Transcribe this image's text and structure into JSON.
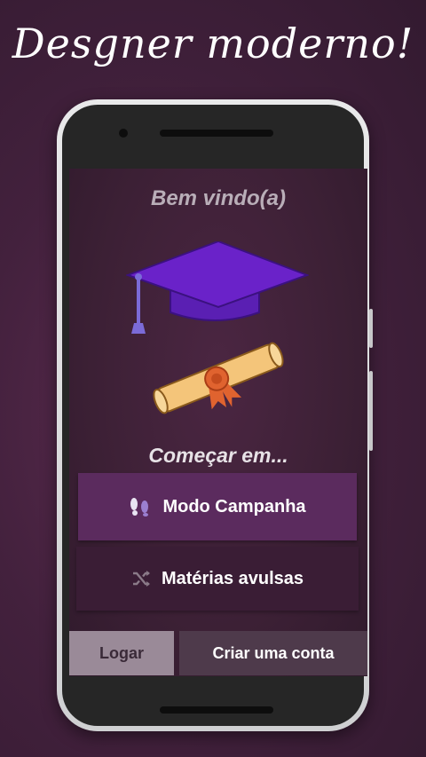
{
  "banner": {
    "headline": "Desgner moderno!"
  },
  "screen": {
    "welcome": "Bem vindo(a)",
    "start_prompt": "Começar em...",
    "buttons": {
      "campaign": "Modo Campanha",
      "subjects": "Matérias avulsas"
    },
    "footer": {
      "login": "Logar",
      "register": "Criar uma conta"
    }
  },
  "icons": {
    "graduation": "graduation-cap-icon",
    "diploma": "diploma-icon",
    "campaign": "footprints-icon",
    "subjects": "shuffle-icon"
  },
  "colors": {
    "cap": "#6a22c9",
    "diploma": "#f4c57a",
    "ribbon": "#e0632f",
    "campaign_button": "#5b2b5e",
    "subjects_button": "#3a1d35",
    "login_button": "#9a8a98",
    "register_button": "#4e3a4b"
  }
}
